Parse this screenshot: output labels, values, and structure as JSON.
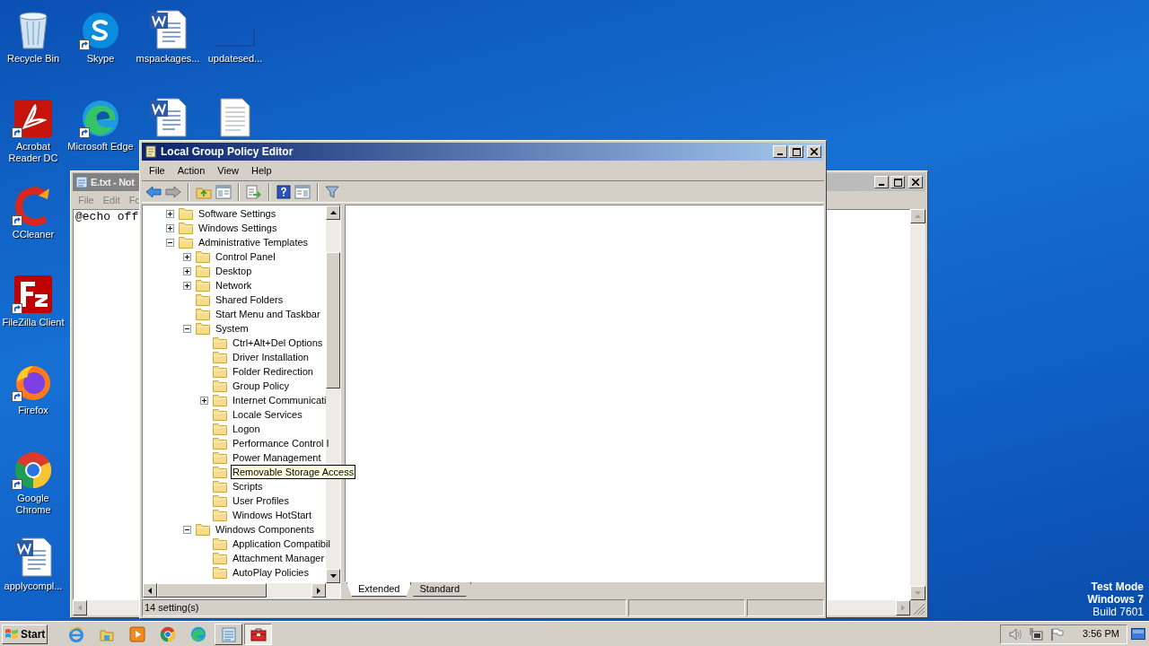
{
  "desktop_columns": [
    [
      {
        "label": "Recycle Bin",
        "kind": "recycle",
        "shortcut": false
      },
      {
        "label": "Acrobat Reader DC",
        "kind": "acrobat",
        "shortcut": true
      },
      {
        "label": "CCleaner",
        "kind": "ccleaner",
        "shortcut": true
      },
      {
        "label": "FileZilla Client",
        "kind": "filezilla",
        "shortcut": true
      },
      {
        "label": "Firefox",
        "kind": "firefox",
        "shortcut": true
      },
      {
        "label": "Google Chrome",
        "kind": "chrome",
        "shortcut": true
      },
      {
        "label": "applycompl...",
        "kind": "word",
        "shortcut": false
      }
    ],
    [
      {
        "label": "Skype",
        "kind": "skype",
        "shortcut": true
      },
      {
        "label": "Microsoft Edge",
        "kind": "edge",
        "shortcut": true
      }
    ],
    [
      {
        "label": "mspackages...",
        "kind": "word",
        "shortcut": false
      },
      {
        "kind": "word",
        "shortcut": false
      }
    ],
    [
      {
        "label": "updatesed...",
        "kind": "blank",
        "shortcut": false
      },
      {
        "kind": "text",
        "shortcut": false
      }
    ]
  ],
  "notepad": {
    "title": "E.txt - Not",
    "menu": [
      "File",
      "Edit",
      "Fo"
    ],
    "content": "@echo off"
  },
  "window": {
    "title": "Local Group Policy Editor",
    "menu": [
      "File",
      "Action",
      "View",
      "Help"
    ],
    "toolbar": [
      {
        "kind": "back"
      },
      {
        "kind": "forward"
      },
      {
        "kind": "sep"
      },
      {
        "kind": "up"
      },
      {
        "kind": "tree"
      },
      {
        "kind": "sep"
      },
      {
        "kind": "export"
      },
      {
        "kind": "sep"
      },
      {
        "kind": "help"
      },
      {
        "kind": "pane"
      },
      {
        "kind": "sep"
      },
      {
        "kind": "filter"
      }
    ],
    "tree": [
      {
        "label": "Software Settings",
        "kind": "branch",
        "expanded": false,
        "hovered": false
      },
      {
        "label": "Windows Settings",
        "kind": "branch",
        "expanded": false,
        "hovered": false
      },
      {
        "label": "Administrative Templates",
        "kind": "branch",
        "expanded": true,
        "hovered": false,
        "children": [
          {
            "label": "Control Panel",
            "kind": "branch",
            "expanded": false,
            "hovered": false
          },
          {
            "label": "Desktop",
            "kind": "branch",
            "expanded": false,
            "hovered": false
          },
          {
            "label": "Network",
            "kind": "branch",
            "expanded": false,
            "hovered": false
          },
          {
            "label": "Shared Folders",
            "kind": "leaf",
            "hovered": false
          },
          {
            "label": "Start Menu and Taskbar",
            "kind": "leaf",
            "hovered": false
          },
          {
            "label": "System",
            "kind": "branch",
            "expanded": true,
            "hovered": false,
            "children": [
              {
                "label": "Ctrl+Alt+Del Options",
                "kind": "leaf",
                "hovered": false
              },
              {
                "label": "Driver Installation",
                "kind": "leaf",
                "hovered": false
              },
              {
                "label": "Folder Redirection",
                "kind": "leaf",
                "hovered": false
              },
              {
                "label": "Group Policy",
                "kind": "leaf",
                "hovered": false
              },
              {
                "label": "Internet Communicati",
                "kind": "branch",
                "expanded": false,
                "hovered": false
              },
              {
                "label": "Locale Services",
                "kind": "leaf",
                "hovered": false
              },
              {
                "label": "Logon",
                "kind": "leaf",
                "hovered": false
              },
              {
                "label": "Performance Control I",
                "kind": "leaf",
                "hovered": false
              },
              {
                "label": "Power Management",
                "kind": "leaf",
                "hovered": false
              },
              {
                "label": "Removable Storage Access",
                "kind": "leaf",
                "hovered": true
              },
              {
                "label": "Scripts",
                "kind": "leaf",
                "hovered": false
              },
              {
                "label": "User Profiles",
                "kind": "leaf",
                "hovered": false
              },
              {
                "label": "Windows HotStart",
                "kind": "leaf",
                "hovered": false
              }
            ]
          },
          {
            "label": "Windows Components",
            "kind": "branch",
            "expanded": true,
            "hovered": false,
            "children": [
              {
                "label": "Application Compatibil",
                "kind": "leaf",
                "hovered": false
              },
              {
                "label": "Attachment Manager",
                "kind": "leaf",
                "hovered": false
              },
              {
                "label": "AutoPlay Policies",
                "kind": "leaf",
                "hovered": false
              }
            ]
          }
        ]
      }
    ],
    "tabs": [
      {
        "label": "Extended",
        "selected": true
      },
      {
        "label": "Standard",
        "selected": false
      }
    ],
    "status_bar": [
      "14 setting(s)"
    ]
  },
  "desktop_text": [
    {
      "text": "Test Mode",
      "emphasis": true
    },
    {
      "text": "Windows 7",
      "emphasis": true
    },
    {
      "text": "Build 7601",
      "emphasis": false
    }
  ],
  "taskbar": {
    "start": "Start",
    "apps": [
      {
        "kind": "ie",
        "active": false
      },
      {
        "kind": "explorer",
        "active": false
      },
      {
        "kind": "media",
        "active": false
      },
      {
        "kind": "chrome",
        "active": false
      },
      {
        "kind": "edge",
        "active": false
      },
      {
        "kind": "notepad",
        "active": false
      },
      {
        "kind": "toolbox",
        "active": true
      }
    ],
    "tray": [
      {
        "kind": "speaker"
      },
      {
        "kind": "network"
      },
      {
        "kind": "flag"
      }
    ],
    "clock": "3:56 PM"
  }
}
